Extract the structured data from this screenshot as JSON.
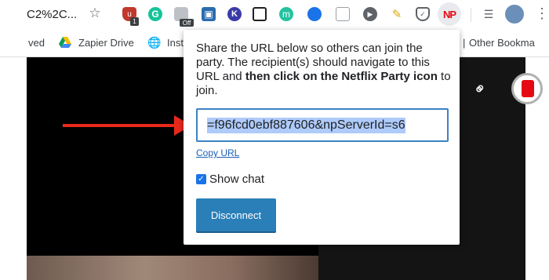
{
  "toolbar": {
    "url_fragment": "C2%2C...",
    "star_glyph": "☆",
    "ublock_badge": "1",
    "off_badge": "Off",
    "extensions": [
      "ublock-icon",
      "grammarly-icon",
      "trash-icon",
      "book-icon",
      "k-icon",
      "pip-icon",
      "m-icon",
      "eye-icon",
      "doc-icon",
      "play-icon",
      "broom-icon",
      "pocket-icon",
      "netflix-party-icon",
      "queue-icon"
    ],
    "np_label": "NP",
    "grammarly_letter": "G",
    "k_letter": "K",
    "m_letter": "m"
  },
  "bookmarks": {
    "saved_fragment": "ved",
    "zapier_drive": "Zapier Drive",
    "inst_fragment": "Inst",
    "separator": "|",
    "other_bookmarks": "Other Bookma"
  },
  "popup": {
    "text_part1": "Share the URL below so others can join the party. The recipient(s) should navigate to this URL and ",
    "text_bold": "then click on the Netflix Party icon",
    "text_part2": " to join.",
    "url_value": "=f96fcd0ebf887606&npServerId=s6",
    "copy_url_label": "Copy URL",
    "show_chat_label": "Show chat",
    "show_chat_checked": true,
    "disconnect_label": "Disconnect"
  },
  "colors": {
    "arrow": "#e8291c",
    "disconnect_button": "#2a7fb8",
    "url_border": "#3b82c4",
    "netflix_red": "#e50914"
  }
}
